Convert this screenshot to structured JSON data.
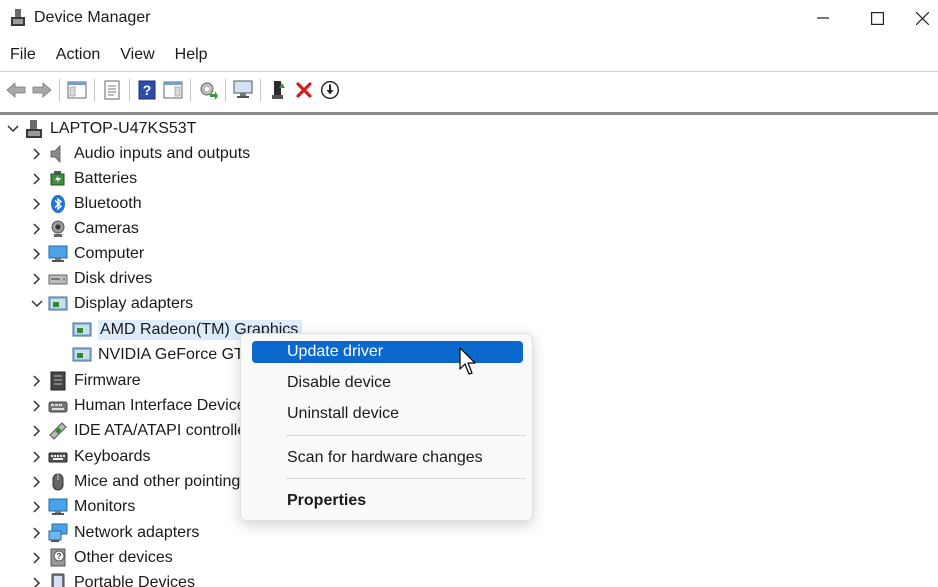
{
  "window": {
    "title": "Device Manager",
    "icons": {
      "app": "device-manager-icon",
      "minimize": "minimize-icon",
      "maximize": "maximize-icon",
      "close": "close-icon"
    }
  },
  "menubar": {
    "items": [
      "File",
      "Action",
      "View",
      "Help"
    ]
  },
  "toolbar": {
    "buttons": [
      "back-arrow-icon",
      "forward-arrow-icon",
      "show-hide-console-tree-icon",
      "properties-icon",
      "help-icon",
      "action-pane-icon",
      "update-driver-icon",
      "scan-hardware-icon",
      "enable-device-icon",
      "uninstall-device-icon",
      "disable-device-icon"
    ]
  },
  "tree": {
    "root": "LAPTOP-U47KS53T",
    "categories": [
      {
        "label": "Audio inputs and outputs",
        "icon": "speaker-icon"
      },
      {
        "label": "Batteries",
        "icon": "battery-icon"
      },
      {
        "label": "Bluetooth",
        "icon": "bluetooth-icon"
      },
      {
        "label": "Cameras",
        "icon": "camera-icon"
      },
      {
        "label": "Computer",
        "icon": "computer-icon"
      },
      {
        "label": "Disk drives",
        "icon": "disk-drive-icon"
      },
      {
        "label": "Display adapters",
        "icon": "display-adapter-icon"
      },
      {
        "label": "Firmware",
        "icon": "firmware-icon"
      },
      {
        "label": "Human Interface Devices",
        "icon": "hid-icon"
      },
      {
        "label": "IDE ATA/ATAPI controllers",
        "icon": "ide-controller-icon"
      },
      {
        "label": "Keyboards",
        "icon": "keyboard-icon"
      },
      {
        "label": "Mice and other pointing",
        "icon": "mouse-icon"
      },
      {
        "label": "Monitors",
        "icon": "monitor-icon"
      },
      {
        "label": "Network adapters",
        "icon": "network-adapter-icon"
      },
      {
        "label": "Other devices",
        "icon": "other-devices-icon"
      },
      {
        "label": "Portable Devices",
        "icon": "portable-device-icon"
      }
    ],
    "display_children": [
      {
        "label": "AMD Radeon(TM) Graphics",
        "selected": true
      },
      {
        "label": "NVIDIA GeForce GTX",
        "selected": false
      }
    ]
  },
  "context_menu": {
    "items": [
      "Update driver",
      "Disable device",
      "Uninstall device",
      "Scan for hardware changes",
      "Properties"
    ],
    "highlighted": "Update driver"
  },
  "colors": {
    "highlight": "#0a68cf",
    "selection": "#dcecfc"
  }
}
